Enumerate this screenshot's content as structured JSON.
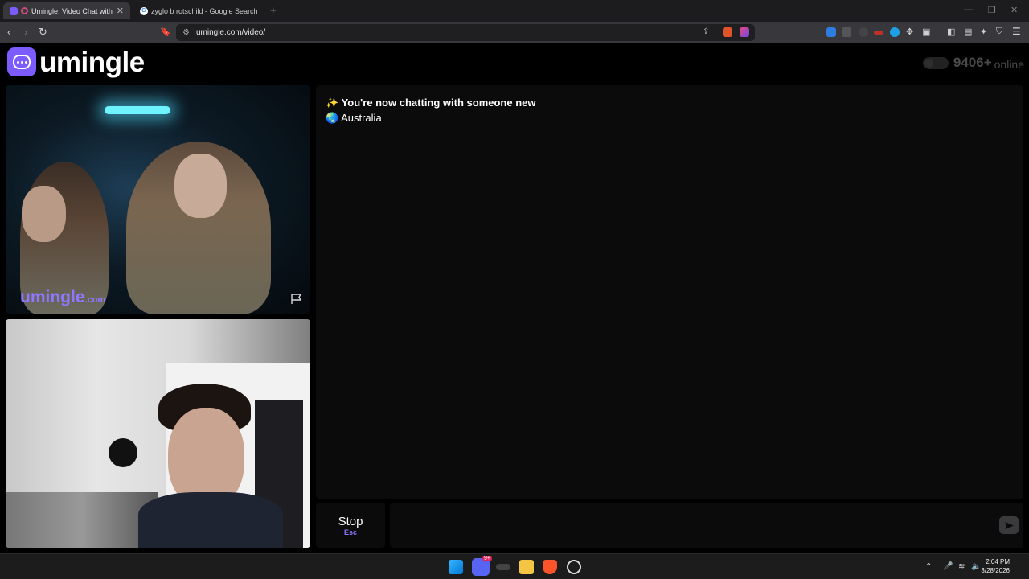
{
  "browser": {
    "tabs": [
      {
        "title": "Umingle: Video Chat with Str",
        "active": true
      },
      {
        "title": "zyglo b rotschild - Google Search",
        "active": false
      }
    ],
    "url": "umingle.com/video/"
  },
  "site": {
    "logo_text": "umingle",
    "online_count": "9406+",
    "online_label": "online"
  },
  "remote_video": {
    "watermark": "umingle",
    "watermark_suffix": ".com"
  },
  "chat": {
    "messages": [
      {
        "icon": "✨",
        "text": "You're now chatting with someone new"
      },
      {
        "icon": "🌏",
        "text": "Australia"
      }
    ],
    "stop_label": "Stop",
    "stop_hint": "Esc",
    "input_value": ""
  },
  "taskbar": {
    "time": "2:04 PM",
    "date": "3/28/2026",
    "discord_badge": "9+"
  },
  "colors": {
    "brand": "#7c5cff",
    "watermark": "#8d78ff",
    "panel": "#0b0b0c"
  }
}
